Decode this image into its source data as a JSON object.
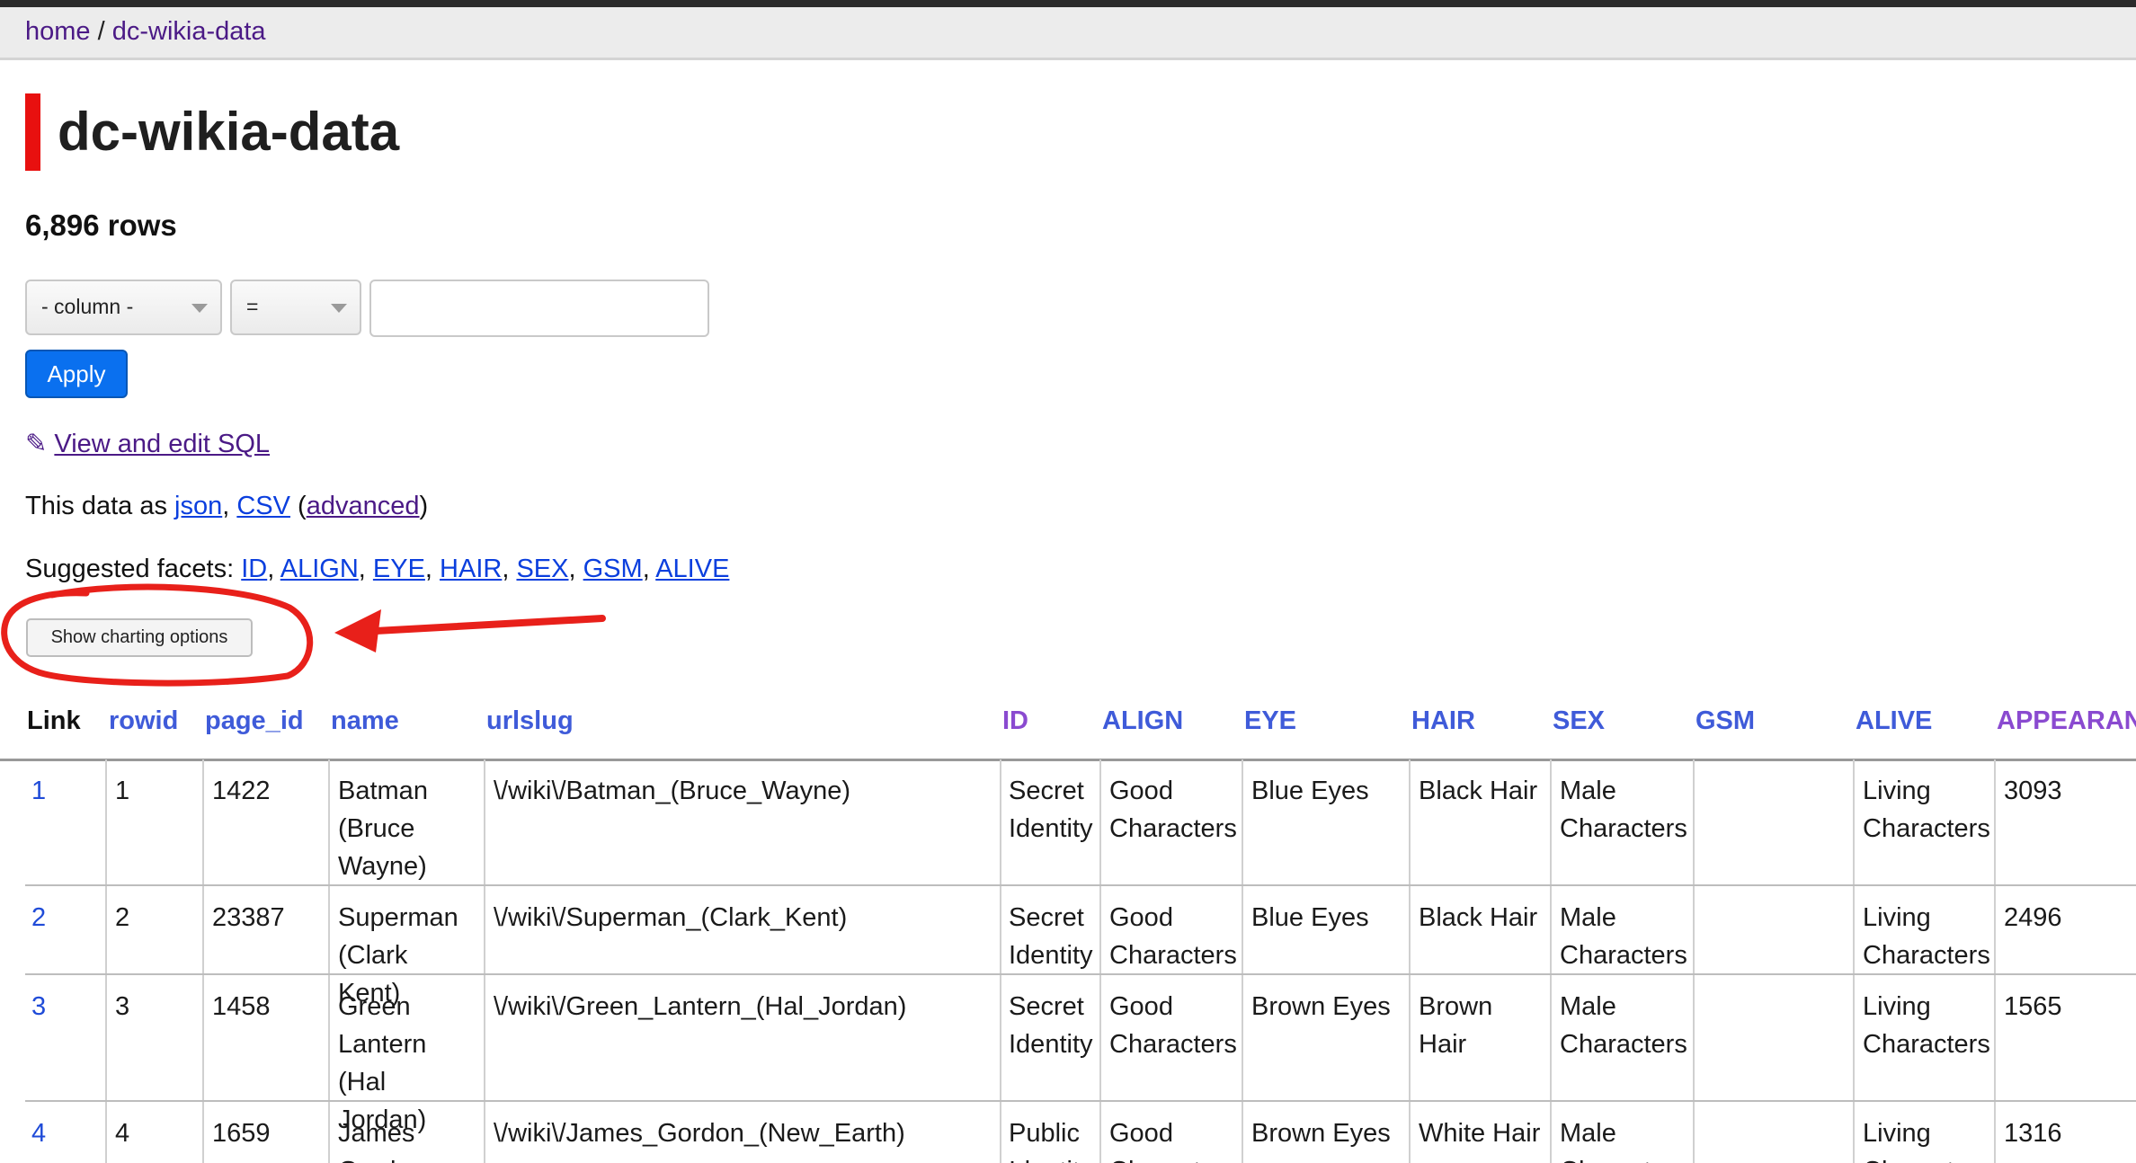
{
  "breadcrumb": {
    "home": "home",
    "separator": " / ",
    "database": "dc-wikia-data"
  },
  "page_title": "dc-wikia-data",
  "row_count": "6,896 rows",
  "filter": {
    "column_select": "- column -",
    "op_select": "=",
    "value": "",
    "apply_label": "Apply"
  },
  "sql": {
    "icon": "✎",
    "link_label": "View and edit SQL"
  },
  "export": {
    "prefix": "This data as ",
    "json": "json",
    "sep1": ", ",
    "csv": "CSV",
    "open": " (",
    "advanced": "advanced",
    "close": ")"
  },
  "facets": {
    "label": "Suggested facets: ",
    "items": [
      "ID",
      "ALIGN",
      "EYE",
      "HAIR",
      "SEX",
      "GSM",
      "ALIVE"
    ]
  },
  "charting_button": "Show charting options",
  "table": {
    "headers": [
      "Link",
      "rowid",
      "page_id",
      "name",
      "urlslug",
      "ID",
      "ALIGN",
      "EYE",
      "HAIR",
      "SEX",
      "GSM",
      "ALIVE",
      "APPEARAN"
    ],
    "rows": [
      {
        "link": "1",
        "rowid": "1",
        "page_id": "1422",
        "name": "Batman (Bruce Wayne)",
        "urlslug": "\\/wiki\\/Batman_(Bruce_Wayne)",
        "id": "Secret Identity",
        "align": "Good Characters",
        "eye": "Blue Eyes",
        "hair": "Black Hair",
        "sex": "Male Characters",
        "gsm": "",
        "alive": "Living Characters",
        "appearances": "3093"
      },
      {
        "link": "2",
        "rowid": "2",
        "page_id": "23387",
        "name": "Superman (Clark Kent)",
        "urlslug": "\\/wiki\\/Superman_(Clark_Kent)",
        "id": "Secret Identity",
        "align": "Good Characters",
        "eye": "Blue Eyes",
        "hair": "Black Hair",
        "sex": "Male Characters",
        "gsm": "",
        "alive": "Living Characters",
        "appearances": "2496"
      },
      {
        "link": "3",
        "rowid": "3",
        "page_id": "1458",
        "name": "Green Lantern (Hal Jordan)",
        "urlslug": "\\/wiki\\/Green_Lantern_(Hal_Jordan)",
        "id": "Secret Identity",
        "align": "Good Characters",
        "eye": "Brown Eyes",
        "hair": "Brown Hair",
        "sex": "Male Characters",
        "gsm": "",
        "alive": "Living Characters",
        "appearances": "1565"
      },
      {
        "link": "4",
        "rowid": "4",
        "page_id": "1659",
        "name": "James Gordon",
        "urlslug": "\\/wiki\\/James_Gordon_(New_Earth)",
        "id": "Public Identity",
        "align": "Good Characters",
        "eye": "Brown Eyes",
        "hair": "White Hair",
        "sex": "Male Characters",
        "gsm": "",
        "alive": "Living Characters",
        "appearances": "1316"
      }
    ]
  },
  "colors": {
    "annotation": "#e8201a",
    "link": "#0b3fde",
    "visited": "#4b1a86",
    "header": "#3f5bd9",
    "button": "#0a70ef"
  }
}
